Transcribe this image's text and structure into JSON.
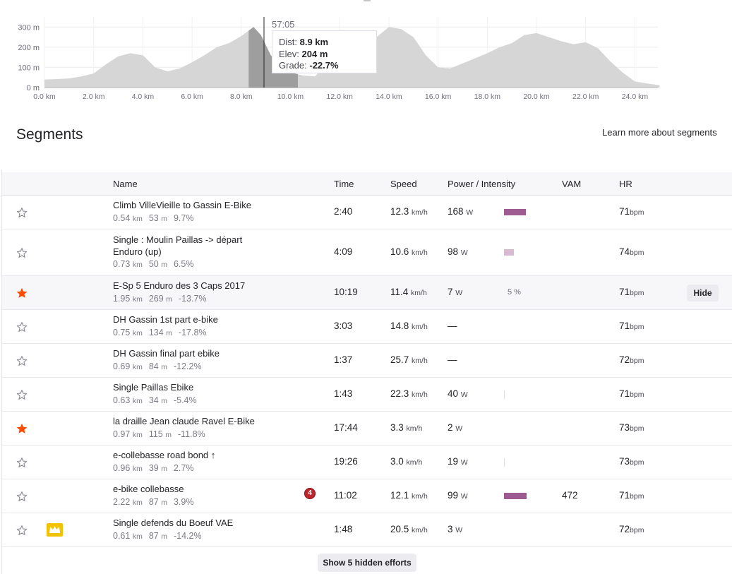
{
  "elevation": {
    "y_ticks": [
      "300 m",
      "200 m",
      "100 m",
      "0 m"
    ],
    "x_ticks": [
      "0.0 km",
      "2.0 km",
      "4.0 km",
      "6.0 km",
      "8.0 km",
      "10.0 km",
      "12.0 km",
      "14.0 km",
      "16.0 km",
      "18.0 km",
      "20.0 km",
      "22.0 km",
      "24.0 km"
    ],
    "time_label": "57:05",
    "tooltip": {
      "dist_label": "Dist: ",
      "dist_value": "8.9 km",
      "elev_label": "Elev: ",
      "elev_value": "204 m",
      "grade_label": "Grade: ",
      "grade_value": "-22.7%"
    },
    "profile_km": [
      0.0,
      0.5,
      1.0,
      1.5,
      2.0,
      2.5,
      3.0,
      3.5,
      4.0,
      4.5,
      5.0,
      5.5,
      6.0,
      6.5,
      7.0,
      7.5,
      8.0,
      8.5,
      8.8,
      9.2,
      9.6,
      10.0,
      10.5,
      11.0,
      11.5,
      12.0,
      12.5,
      13.0,
      13.5,
      14.0,
      14.5,
      15.0,
      15.5,
      16.0,
      16.5,
      17.0,
      17.5,
      18.0,
      18.5,
      19.0,
      19.5,
      20.0,
      20.5,
      21.0,
      21.5,
      22.0,
      22.5,
      23.0,
      23.5,
      24.0,
      24.5,
      25.0
    ],
    "profile_m": [
      40,
      42,
      45,
      55,
      70,
      115,
      155,
      170,
      160,
      100,
      80,
      95,
      125,
      160,
      200,
      220,
      255,
      300,
      260,
      160,
      105,
      75,
      60,
      55,
      120,
      200,
      260,
      270,
      250,
      300,
      290,
      250,
      160,
      100,
      95,
      120,
      145,
      170,
      200,
      220,
      260,
      270,
      250,
      230,
      215,
      225,
      195,
      130,
      75,
      30,
      20,
      12
    ]
  },
  "segments": {
    "title": "Segments",
    "learn_more": "Learn more about segments",
    "columns": {
      "name": "Name",
      "time": "Time",
      "speed": "Speed",
      "power": "Power / Intensity",
      "vam": "VAM",
      "hr": "HR"
    },
    "speed_unit": "km/h",
    "power_unit": "W",
    "hr_unit": "bpm",
    "dist_unit": "km",
    "elev_unit": "m",
    "hide_label": "Hide",
    "show_hidden": "Show 5 hidden efforts",
    "colors": {
      "star_filled": "#fc4c02",
      "star_outline": "#8b8b93",
      "bar_strong": "#9e5b92",
      "bar_light": "#d9b9d2",
      "bar_faint": "#dedede",
      "crown": "#f2c200"
    }
  },
  "rows": [
    {
      "name": [
        "Climb VilleVieille to Gassin E-Bike"
      ],
      "dist": "0.54",
      "elev": "53",
      "grade": "9.7%",
      "time": "2:40",
      "speed": "12.3",
      "power": "168",
      "intensity": 0.85,
      "bar": "strong",
      "vam": "",
      "hr": "71",
      "starred": false
    },
    {
      "name": [
        "Single : Moulin Paillas -> départ",
        "Enduro (up)"
      ],
      "dist": "0.73",
      "elev": "50",
      "grade": "6.5%",
      "time": "4:09",
      "speed": "10.6",
      "power": "98",
      "intensity": 0.4,
      "bar": "light",
      "vam": "",
      "hr": "74",
      "starred": false
    },
    {
      "name": [
        "E-Sp 5 Enduro des 3 Caps 2017"
      ],
      "dist": "1.95",
      "elev": "269",
      "grade": "-13.7%",
      "time": "10:19",
      "speed": "11.4",
      "power": "7",
      "intensity_text": "5 %",
      "vam": "",
      "hr": "71",
      "starred": true,
      "highlight": true,
      "hide_button": true
    },
    {
      "name": [
        "DH Gassin 1st part e-bike"
      ],
      "dist": "0.75",
      "elev": "134",
      "grade": "-17.8%",
      "time": "3:03",
      "speed": "14.8",
      "power_text": "—",
      "vam": "",
      "hr": "71",
      "starred": false
    },
    {
      "name": [
        "DH Gassin final part ebike"
      ],
      "dist": "0.69",
      "elev": "84",
      "grade": "-12.2%",
      "time": "1:37",
      "speed": "25.7",
      "power_text": "—",
      "vam": "",
      "hr": "72",
      "starred": false
    },
    {
      "name": [
        "Single Paillas Ebike"
      ],
      "dist": "0.63",
      "elev": "34",
      "grade": "-5.4%",
      "time": "1:43",
      "speed": "22.3",
      "power": "40",
      "intensity": 0.02,
      "bar": "faint",
      "vam": "",
      "hr": "71",
      "starred": false
    },
    {
      "name": [
        "la draille Jean claude Ravel E-Bike"
      ],
      "dist": "0.97",
      "elev": "115",
      "grade": "-11.8%",
      "time": "17:44",
      "speed": "3.3",
      "power": "2",
      "vam": "",
      "hr": "73",
      "starred": true
    },
    {
      "name": [
        "e-collebasse road bond ↑"
      ],
      "dist": "0.96",
      "elev": "39",
      "grade": "2.7%",
      "time": "19:26",
      "speed": "3.0",
      "power": "19",
      "intensity": 0.03,
      "bar": "faint",
      "vam": "",
      "hr": "73",
      "starred": false
    },
    {
      "name": [
        "e-bike collebasse"
      ],
      "dist": "2.22",
      "elev": "87",
      "grade": "3.9%",
      "time": "11:02",
      "speed": "12.1",
      "power": "99",
      "intensity": 0.88,
      "bar": "strong",
      "vam": "472",
      "hr": "71",
      "starred": false,
      "badge": "4"
    },
    {
      "name": [
        "Single defends du Boeuf VAE"
      ],
      "dist": "0.61",
      "elev": "87",
      "grade": "-14.2%",
      "time": "1:48",
      "speed": "20.5",
      "power": "3",
      "vam": "",
      "hr": "72",
      "starred": false,
      "crown": true
    }
  ]
}
